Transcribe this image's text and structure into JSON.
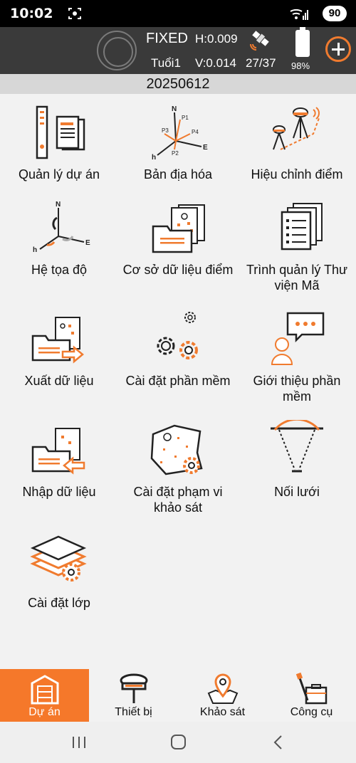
{
  "status_bar": {
    "time": "10:02",
    "battery": "90",
    "icons": [
      "screen-record-icon",
      "wifi-icon",
      "signal-icon"
    ]
  },
  "gnss": {
    "solution": "FIXED",
    "h_precision": "H:0.009",
    "v_precision": "V:0.014",
    "name": "Tuổi1",
    "satellites": "27/37",
    "battery_pct": "98%",
    "accent": "#f07b2f"
  },
  "project": {
    "name": "20250612"
  },
  "menu": [
    {
      "label": "Quản lý dự án",
      "icon": "project-manager-icon"
    },
    {
      "label": "Bản địa hóa",
      "icon": "localization-icon"
    },
    {
      "label": "Hiệu chỉnh điểm",
      "icon": "point-calibration-icon"
    },
    {
      "label": "Hệ tọa độ",
      "icon": "coordinate-system-icon"
    },
    {
      "label": "Cơ sở dữ liệu điểm",
      "icon": "point-database-icon"
    },
    {
      "label": "Trình quản lý Thư viện Mã",
      "icon": "code-library-icon"
    },
    {
      "label": "Xuất dữ liệu",
      "icon": "export-data-icon"
    },
    {
      "label": "Cài đặt phần mềm",
      "icon": "software-settings-icon"
    },
    {
      "label": "Giới thiệu phần mềm",
      "icon": "about-software-icon"
    },
    {
      "label": "Nhập dữ liệu",
      "icon": "import-data-icon"
    },
    {
      "label": "Cài đặt phạm vi khảo sát",
      "icon": "survey-range-icon"
    },
    {
      "label": "Nối lưới",
      "icon": "grid-connection-icon"
    },
    {
      "label": "Cài đặt lớp",
      "icon": "layer-settings-icon"
    }
  ],
  "bottom_nav": [
    {
      "label": "Dự án",
      "icon": "project-icon",
      "active": true
    },
    {
      "label": "Thiết bị",
      "icon": "device-icon",
      "active": false
    },
    {
      "label": "Khảo sát",
      "icon": "survey-icon",
      "active": false
    },
    {
      "label": "Công cụ",
      "icon": "tools-icon",
      "active": false
    }
  ],
  "system_nav": [
    "recent-apps-icon",
    "home-icon",
    "back-icon"
  ]
}
